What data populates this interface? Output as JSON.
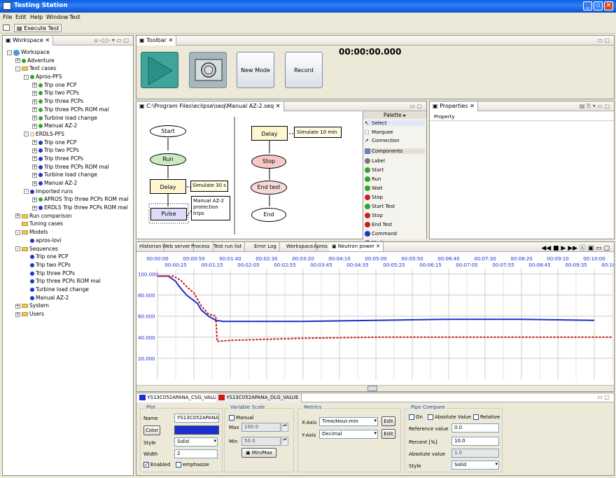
{
  "window": {
    "title": "Testing Station"
  },
  "menu": [
    "File",
    "Edit",
    "Help",
    "Window",
    "Test"
  ],
  "toolbar": {
    "execute_tab": "Execute Test"
  },
  "workspace_view": {
    "tab": "Workspace",
    "tree": [
      {
        "level": 0,
        "kind": "root",
        "label": "Workspace",
        "exp": "-"
      },
      {
        "level": 1,
        "kind": "dotg",
        "label": "Adventure",
        "exp": "+"
      },
      {
        "level": 1,
        "kind": "fold",
        "label": "Test cases",
        "exp": "-"
      },
      {
        "level": 2,
        "kind": "dotg",
        "label": "Apros-PFS",
        "exp": "-"
      },
      {
        "level": 3,
        "kind": "dotg",
        "label": "Trip one PCP",
        "exp": "+"
      },
      {
        "level": 3,
        "kind": "dotg",
        "label": "Trip two PCPs",
        "exp": "+"
      },
      {
        "level": 3,
        "kind": "dotg",
        "label": "Trip three PCPs",
        "exp": "+"
      },
      {
        "level": 3,
        "kind": "dotg",
        "label": "Trip three PCPs ROM mal",
        "exp": "+"
      },
      {
        "level": 3,
        "kind": "dotg",
        "label": "Turbine load change",
        "exp": "+"
      },
      {
        "level": 3,
        "kind": "dotg",
        "label": "Manual AZ-2",
        "exp": "+"
      },
      {
        "level": 2,
        "kind": "dotw",
        "label": "ERDLS-PFS",
        "exp": "-"
      },
      {
        "level": 3,
        "kind": "dotb",
        "label": "Trip one PCP",
        "exp": "+"
      },
      {
        "level": 3,
        "kind": "dotb",
        "label": "Trip two PCPs",
        "exp": "+"
      },
      {
        "level": 3,
        "kind": "dotb",
        "label": "Trip three PCPs",
        "exp": "+"
      },
      {
        "level": 3,
        "kind": "dotb",
        "label": "Trip three PCPs ROM mal",
        "exp": "+"
      },
      {
        "level": 3,
        "kind": "dotb",
        "label": "Turbine load change",
        "exp": "+"
      },
      {
        "level": 3,
        "kind": "dotb",
        "label": "Manual AZ-2",
        "exp": "+"
      },
      {
        "level": 2,
        "kind": "dotb",
        "label": "Imported runs",
        "exp": "-"
      },
      {
        "level": 3,
        "kind": "dotg",
        "label": "APROS Trip three PCPs ROM mal",
        "exp": "+"
      },
      {
        "level": 3,
        "kind": "dotb",
        "label": "ERDLS Trip three PCPs ROM mal",
        "exp": "+"
      },
      {
        "level": 1,
        "kind": "fold",
        "label": "Run comparison",
        "exp": "+"
      },
      {
        "level": 1,
        "kind": "fold",
        "label": "Tuning cases",
        "exp": ""
      },
      {
        "level": 1,
        "kind": "fold",
        "label": "Models",
        "exp": "-"
      },
      {
        "level": 2,
        "kind": "dotb",
        "label": "apros-lovi",
        "exp": ""
      },
      {
        "level": 1,
        "kind": "fold",
        "label": "Sequences",
        "exp": "-"
      },
      {
        "level": 2,
        "kind": "dotb",
        "label": "Trip one PCP",
        "exp": ""
      },
      {
        "level": 2,
        "kind": "dotb",
        "label": "Trip two PCPs",
        "exp": ""
      },
      {
        "level": 2,
        "kind": "dotb",
        "label": "Trip three PCPs",
        "exp": ""
      },
      {
        "level": 2,
        "kind": "dotb",
        "label": "Trip three PCPs ROM mal",
        "exp": ""
      },
      {
        "level": 2,
        "kind": "dotb",
        "label": "Turbine load change",
        "exp": ""
      },
      {
        "level": 2,
        "kind": "dotb",
        "label": "Manual AZ-2",
        "exp": ""
      },
      {
        "level": 1,
        "kind": "fold",
        "label": "System",
        "exp": "+"
      },
      {
        "level": 1,
        "kind": "fold",
        "label": "Users",
        "exp": "+"
      }
    ]
  },
  "toolbar_view": {
    "tab": "Toolbar",
    "timer": "00:00:00.000",
    "new_mode": "New Mode",
    "record": "Record"
  },
  "editor": {
    "tab": "C:\\Program Files\\eclipse\\seq\\Manual AZ-2.seq",
    "nodes": {
      "start": "Start",
      "run": "Run",
      "delay": "Delay",
      "pulse": "Pulse",
      "delay2": "Delay",
      "stop": "Stop",
      "endtest": "End test",
      "end": "End"
    },
    "notes": {
      "simulate30": "Simulate 30 s",
      "manual": "Manual AZ-2 protection trips",
      "simulate10": "Simulate 10 min"
    },
    "palette": {
      "title": "Palette",
      "tools": [
        "Select",
        "Marquee",
        "Connection"
      ],
      "drawer": "Components",
      "components": [
        "Label",
        "Start",
        "Run",
        "Wait",
        "Stop",
        "Start Test",
        "Stop",
        "End Test",
        "Command",
        "Marker"
      ]
    }
  },
  "properties": {
    "tab": "Properties",
    "header": "Property"
  },
  "trend": {
    "tabs": [
      "Historian",
      "Web server",
      "Process",
      "Test run list",
      "Error Log",
      "Workspace",
      "Apros",
      "Neutron power"
    ],
    "time_top": [
      "00:00:00",
      "00:00:50",
      "00:01:40",
      "00:02:30",
      "00:03:20",
      "00:04:10",
      "00:05:00",
      "00:05:50",
      "00:06:40",
      "00:07:30",
      "00:08:20",
      "00:09:10",
      "00:10:00"
    ],
    "time_bottom": [
      "00:00:25",
      "00:01:15",
      "00:02:05",
      "00:02:55",
      "00:03:45",
      "00:04:35",
      "00:05:25",
      "00:06:15",
      "00:07:05",
      "00:07:55",
      "00:08:45",
      "00:09:35",
      "00:10:25"
    ],
    "y_ticks": [
      "100.000",
      "80.000",
      "60.000",
      "40.000",
      "20.000"
    ]
  },
  "chart_data": {
    "type": "line",
    "x_unit": "seconds",
    "xlim": [
      0,
      625
    ],
    "ylim": [
      0,
      105
    ],
    "series": [
      {
        "name": "YS13C052APANA_CSG_VALUE",
        "color": "#1a2fd0",
        "x": [
          0,
          15,
          25,
          30,
          40,
          55,
          60,
          70,
          80,
          90,
          110,
          200,
          300,
          400,
          500,
          600
        ],
        "y": [
          98,
          98,
          93,
          88,
          80,
          72,
          66,
          60,
          56,
          55,
          55,
          55,
          56,
          57,
          57,
          56
        ]
      },
      {
        "name": "YS13C052APANA_DLG_VALUE",
        "color": "#c81414",
        "x": [
          0,
          22,
          32,
          40,
          50,
          60,
          70,
          80,
          82,
          100,
          150,
          200,
          300,
          400,
          500,
          600,
          625
        ],
        "y": [
          98,
          98,
          94,
          88,
          82,
          70,
          62,
          60,
          36,
          37,
          38,
          39,
          40,
          40,
          40,
          40,
          40
        ]
      }
    ]
  },
  "series_panel": {
    "tabs": [
      "YS13C052APANA_CSG_VALUE",
      "YS13C052APANA_DLG_VALUE"
    ],
    "plot": {
      "title": "Plot",
      "name_label": "Name",
      "name_value": "YS13C052APANAD",
      "color_btn": "Color",
      "style_label": "Style",
      "style_value": "Solid",
      "width_label": "Width",
      "width_value": "2",
      "enabled": "Enabled",
      "emphasize": "emphasize"
    },
    "scale": {
      "title": "Variable Scale",
      "manual": "Manual",
      "max_label": "Max",
      "max_value": "100.0",
      "min_label": "Min",
      "min_value": "50.0",
      "minmax_btn": "Min/Max"
    },
    "metrics": {
      "title": "Metrics",
      "xaxis_label": "X-Axis",
      "xaxis_value": "Time/Hour:min",
      "yaxis_label": "Y-Axis",
      "yaxis_value": "Decimal",
      "edit1": "Edit",
      "edit2": "Edit"
    },
    "compare": {
      "title": "Pipe Compare",
      "on": "On",
      "absolute": "Absolute Value",
      "relative": "Relative",
      "ref_label": "Reference value",
      "ref_value": "0.0",
      "percent_label": "Percent [%]",
      "percent_value": "10.0",
      "abs_label": "Absolute value",
      "abs_value": "1.0",
      "style_label": "Style",
      "style_value": "Solid"
    }
  }
}
